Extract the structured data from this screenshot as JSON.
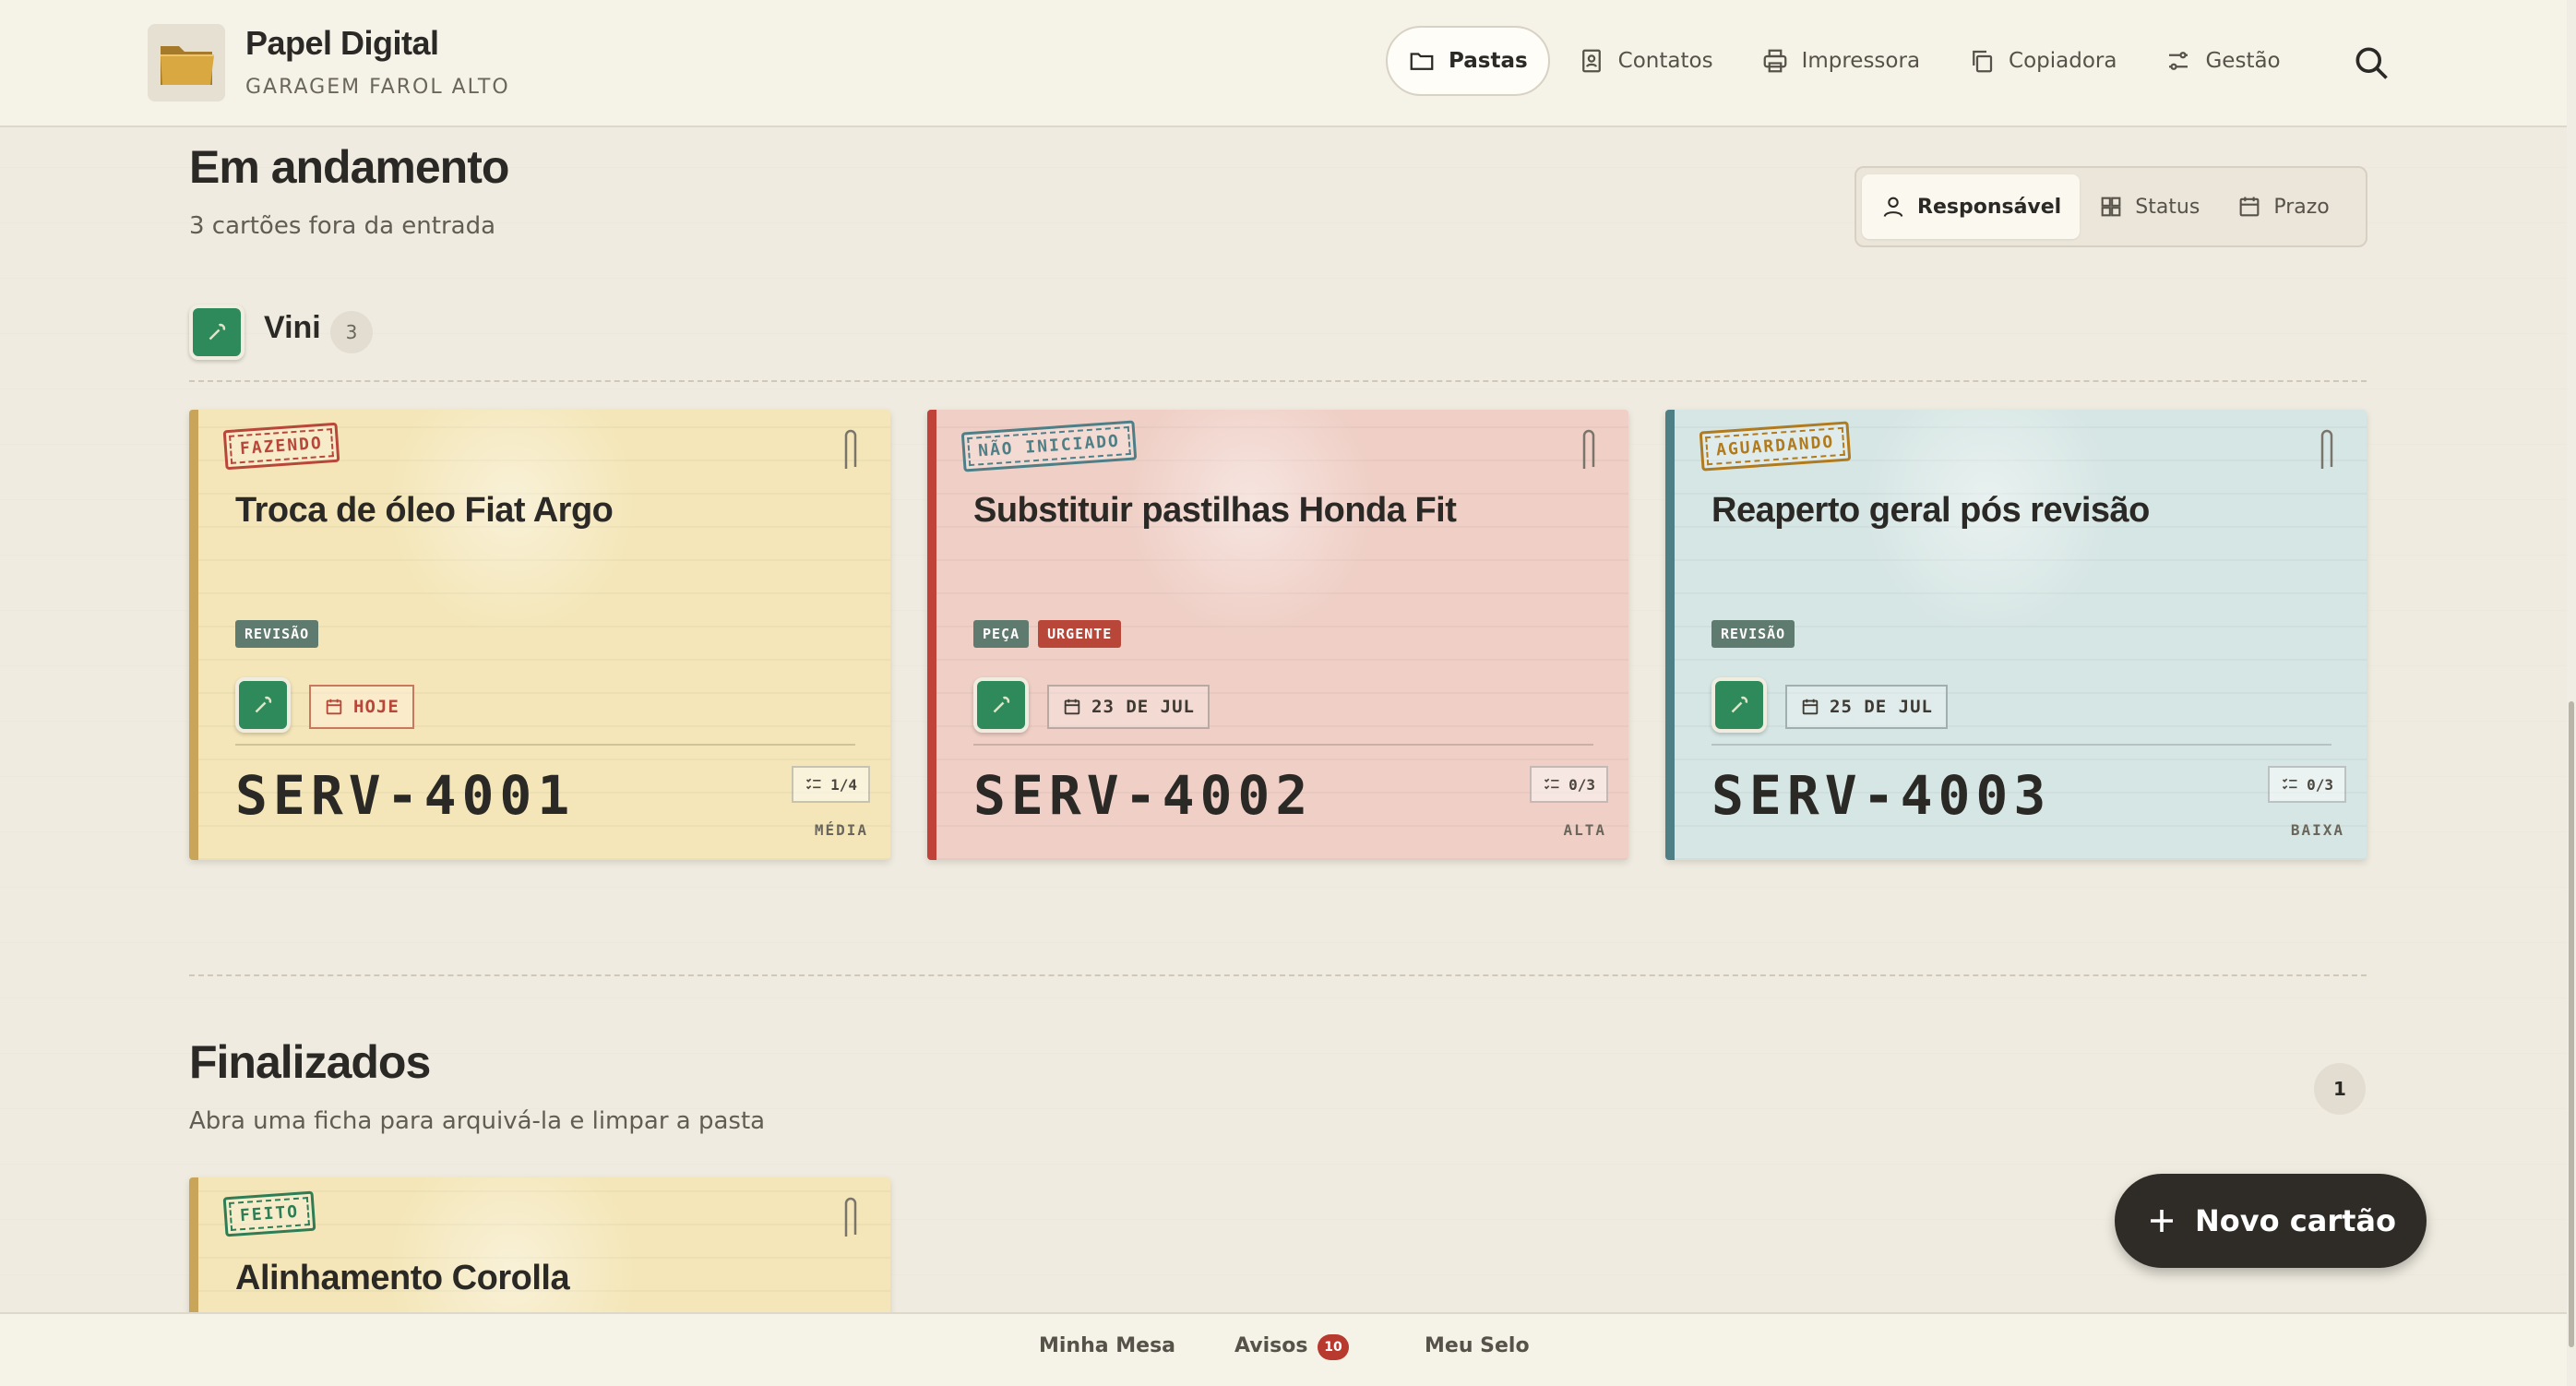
{
  "app": {
    "title": "Papel Digital",
    "subtitle": "GARAGEM FAROL ALTO"
  },
  "nav": {
    "items": [
      {
        "label": "Pastas",
        "icon": "folder-icon",
        "active": true
      },
      {
        "label": "Contatos",
        "icon": "contact-card-icon"
      },
      {
        "label": "Impressora",
        "icon": "printer-icon"
      },
      {
        "label": "Copiadora",
        "icon": "copy-icon"
      },
      {
        "label": "Gestão",
        "icon": "settings-sliders-icon"
      }
    ],
    "search_icon": "search-icon"
  },
  "in_progress": {
    "title": "Em andamento",
    "subtitle": "3 cartões fora da entrada",
    "group_by": [
      {
        "label": "Responsável",
        "active": true
      },
      {
        "label": "Status"
      },
      {
        "label": "Prazo"
      }
    ],
    "group": {
      "name": "Vini",
      "count": "3"
    },
    "cards": [
      {
        "stamp": "FAZENDO",
        "title": "Troca de óleo Fiat Argo",
        "tags": [
          {
            "label": "REVISÃO",
            "color": "#5f7a6e"
          }
        ],
        "date": "HOJE",
        "code": "SERV-4001",
        "checklist": "1/4",
        "priority": "MÉDIA",
        "bg": "#f4e6b8",
        "edge": "#c9a55a",
        "stamp_color": "#b8473a"
      },
      {
        "stamp": "NÃO INICIADO",
        "title": "Substituir pastilhas Honda Fit",
        "tags": [
          {
            "label": "PEÇA",
            "color": "#5f7a6e"
          },
          {
            "label": "URGENTE",
            "color": "#b8473a"
          }
        ],
        "date": "23 DE JUL",
        "code": "SERV-4002",
        "checklist": "0/3",
        "priority": "ALTA",
        "bg": "#efcfc6",
        "edge": "#c0433a",
        "stamp_color": "#4f7f86"
      },
      {
        "stamp": "AGUARDANDO",
        "title": "Reaperto geral pós revisão",
        "tags": [
          {
            "label": "REVISÃO",
            "color": "#5f7a6e"
          }
        ],
        "date": "25 DE JUL",
        "code": "SERV-4003",
        "checklist": "0/3",
        "priority": "BAIXA",
        "bg": "#d6e6e4",
        "edge": "#4f7f86",
        "stamp_color": "#b07a1e"
      }
    ]
  },
  "done": {
    "title": "Finalizados",
    "subtitle": "Abra uma ficha para arquivá-la e limpar a pasta",
    "count": "1",
    "cards": [
      {
        "stamp": "FEITO",
        "title": "Alinhamento Corolla",
        "bg": "#f4e6b8",
        "edge": "#c9a55a",
        "stamp_color": "#2e7d55"
      }
    ]
  },
  "fab": {
    "label": "Novo cartão"
  },
  "bottom": {
    "items": [
      {
        "label": "Minha Mesa"
      },
      {
        "label": "Avisos",
        "badge": "10"
      },
      {
        "label": "Meu Selo"
      }
    ]
  }
}
